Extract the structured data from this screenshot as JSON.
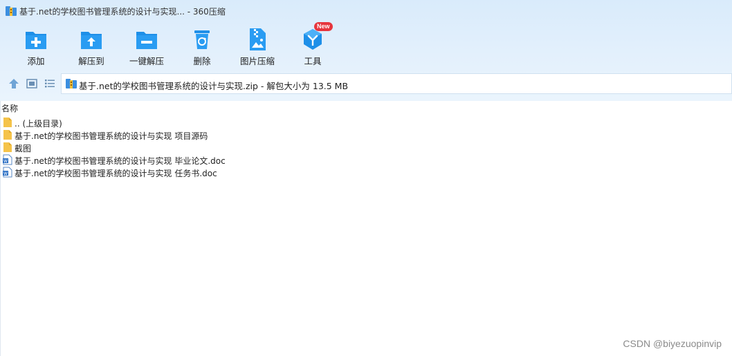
{
  "window": {
    "title": "基于.net的学校图书管理系统的设计与实现... - 360压缩"
  },
  "toolbar": {
    "items": [
      {
        "label": "添加",
        "icon": "add-folder-icon"
      },
      {
        "label": "解压到",
        "icon": "extract-to-folder-icon"
      },
      {
        "label": "一键解压",
        "icon": "one-click-extract-icon"
      },
      {
        "label": "删除",
        "icon": "recycle-bin-icon"
      },
      {
        "label": "图片压缩",
        "icon": "image-zip-icon"
      },
      {
        "label": "工具",
        "icon": "tools-cube-icon",
        "badge": "New"
      }
    ]
  },
  "address": {
    "path": "基于.net的学校图书管理系统的设计与实现.zip - 解包大小为 13.5 MB"
  },
  "list": {
    "column_name": "名称",
    "items": [
      {
        "name": ".. (上级目录)",
        "icon": "folder-icon"
      },
      {
        "name": "基于.net的学校图书管理系统的设计与实现 项目源码",
        "icon": "folder-icon"
      },
      {
        "name": "截图",
        "icon": "folder-icon"
      },
      {
        "name": "基于.net的学校图书管理系统的设计与实现 毕业论文.doc",
        "icon": "word-doc-icon"
      },
      {
        "name": "基于.net的学校图书管理系统的设计与实现 任务书.doc",
        "icon": "word-doc-icon"
      }
    ]
  },
  "watermark": "CSDN @biyezuopinvip",
  "colors": {
    "accent": "#1e8fe8",
    "header_bg": "#dfeefc",
    "badge": "#e6353d",
    "folder": "#f5c34a"
  }
}
